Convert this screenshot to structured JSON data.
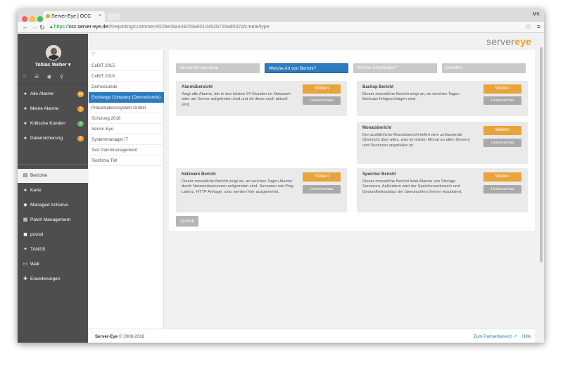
{
  "browser": {
    "tab_title": "Server-Eye | OCC",
    "profile": "MK",
    "url_scheme": "https://",
    "url_host": "occ.server-eye.de",
    "url_path": "/#/reporting/customer/4028e08a449259a6014492b728ad0023/create/type",
    "colors": {
      "close": "#fc605b",
      "minimize": "#fdbc40",
      "maximize": "#34c84a"
    }
  },
  "sidebar": {
    "user_name": "Tobias Weber ▾",
    "icons": [
      "home-icon",
      "list-icon",
      "eye-icon",
      "search-icon"
    ],
    "items": [
      {
        "label": "Alle Alarme",
        "icon": "dot-icon",
        "badge": "46",
        "badge_color": "#e8a33a"
      },
      {
        "label": "Meine Alarme",
        "icon": "dot-icon",
        "badge": "!",
        "badge_color": "#e8a33a"
      },
      {
        "label": "Kritische Kunden",
        "icon": "dot-icon",
        "badge": "2",
        "badge_color": "#5cb85c"
      },
      {
        "label": "Datensicherung",
        "icon": "dot-icon",
        "badge": "!",
        "badge_color": "#e8a33a"
      },
      {
        "label": "Berichte",
        "icon": "chart-icon",
        "active": true
      },
      {
        "label": "Karte",
        "icon": "map-pin-icon"
      },
      {
        "label": "Managed Antivirus",
        "icon": "shield-icon"
      },
      {
        "label": "Patch Management",
        "icon": "grid-icon"
      },
      {
        "label": "pcvisit",
        "icon": "remote-icon"
      },
      {
        "label": "TANSS",
        "icon": "ticket-icon"
      },
      {
        "label": "Wall",
        "icon": "wall-icon"
      },
      {
        "label": "Erweiterungen",
        "icon": "plus-icon"
      }
    ]
  },
  "customers": {
    "filter_icon": "filter-icon",
    "items": [
      "CeBIT 2015",
      "CeBIT 2016",
      "Demockunde",
      "Exchange Company (Demockunde)",
      "Präsentationssystem GmbH",
      "Schulung 2016",
      "Server-Eye",
      "Systemmanager IT",
      "Test Patchmanagement",
      "Testfirma TW"
    ],
    "selected_index": 3
  },
  "logo": {
    "part1": "server",
    "part2": "eye",
    "accent": "#f0a12a"
  },
  "steps": [
    {
      "label": "lab.server-eye.local"
    },
    {
      "label": "Welche Art von Bericht?",
      "active": true
    },
    {
      "label": "Welche Empfänger?"
    },
    {
      "label": "Erstellen"
    }
  ],
  "reports": [
    {
      "title": "Alarmübersicht",
      "description": "Zeigt alle Alarme, die in den letzten 24 Stunden im Netzwerk oder am Server aufgetreten sind und ob diese noch aktuell sind.",
      "choose": "Wählen",
      "preview": "Livevorschau"
    },
    {
      "title": "Backup Bericht",
      "description": "Dieser monatliche Bericht zeigt an, an welchen Tagen Backups fehlgeschlagen sind.",
      "choose": "Wählen",
      "preview": "Livevorschau"
    },
    {
      "title": "Monatsbericht",
      "description": "Der ausführliche Monatsbericht liefert eine umfassende Übersicht über alles, was im letzten Monat an allen Servern und Sensoren angefallen ist.",
      "choose": "Wählen",
      "preview": "Livevorschau"
    },
    {
      "title": "Netzwerk Bericht",
      "description": "Dieser monatliche Bericht zeigt an, an welchen Tagen Alarme durch Netzwerksensoren aufgetreten sind. Sensoren wie Ping Latenz, HTTP Anfrage, usw. werden hier ausgewertet.",
      "choose": "Wählen",
      "preview": "Livevorschau"
    },
    {
      "title": "Speicher Bericht",
      "description": "Dieser monatliche Bericht listet Alarme von Storage Sensoren, Außerdem wird der Speicherverbrauch und Gesundheitsstatus der überwachten Server visualisiert.",
      "choose": "Wählen",
      "preview": "Livevorschau"
    }
  ],
  "back_label": "Zurück",
  "footer": {
    "brand": "Server-Eye",
    "copyright": "© 2008-2016",
    "partner_link": "Zum Partnerbereich ↗",
    "help_link": "Hilfe"
  }
}
